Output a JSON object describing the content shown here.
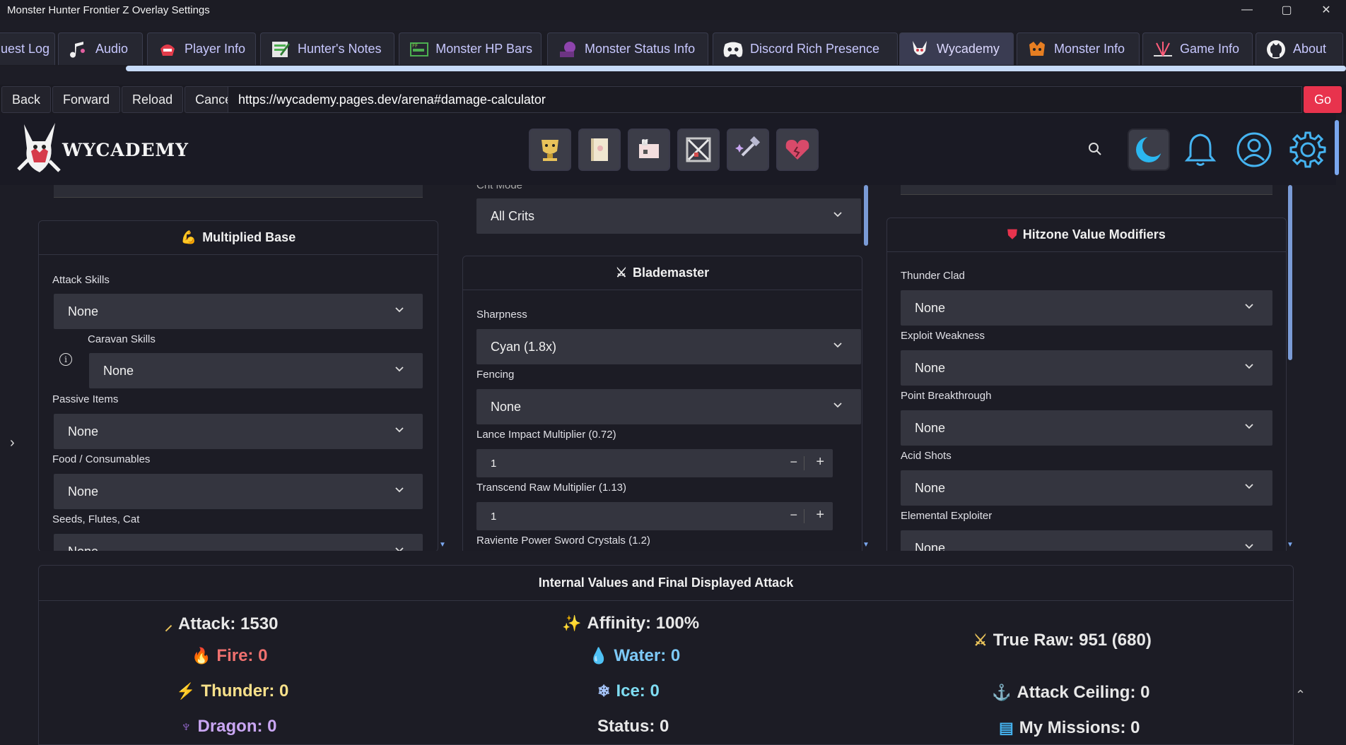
{
  "window": {
    "title": "Monster Hunter Frontier Z Overlay Settings",
    "minimize": "—",
    "maximize": "▢",
    "close": "✕"
  },
  "tabs": [
    {
      "label": "uest Log",
      "icon": "quest-log-icon"
    },
    {
      "label": "Audio",
      "icon": "music-note-icon"
    },
    {
      "label": "Player Info",
      "icon": "player-helmet-icon"
    },
    {
      "label": "Hunter's Notes",
      "icon": "notes-icon"
    },
    {
      "label": "Monster HP Bars",
      "icon": "hp-bars-icon"
    },
    {
      "label": "Monster Status Info",
      "icon": "status-icon"
    },
    {
      "label": "Discord Rich Presence",
      "icon": "discord-icon"
    },
    {
      "label": "Wycademy",
      "icon": "wycademy-icon"
    },
    {
      "label": "Monster Info",
      "icon": "monster-icon"
    },
    {
      "label": "Game Info",
      "icon": "game-info-icon"
    },
    {
      "label": "About",
      "icon": "github-icon"
    }
  ],
  "nav": {
    "back": "Back",
    "forward": "Forward",
    "reload": "Reload",
    "cancel": "Cancel",
    "url": "https://wycademy.pages.dev/arena#damage-calculator",
    "go": "Go"
  },
  "site": {
    "logo_text": "WYCADEMY"
  },
  "left_column": {
    "panel_title": "Multiplied Base",
    "fields": [
      {
        "label": "Attack Skills",
        "value": "None"
      },
      {
        "label": "Caravan Skills",
        "value": "None"
      },
      {
        "label": "Passive Items",
        "value": "None"
      },
      {
        "label": "Food / Consumables",
        "value": "None"
      },
      {
        "label": "Seeds, Flutes, Cat",
        "value": "None"
      }
    ]
  },
  "middle_column": {
    "crit_mode_label": "Crit Mode",
    "crit_mode_value": "All Crits",
    "panel_title": "Blademaster",
    "sharpness_label": "Sharpness",
    "sharpness_value": "Cyan (1.8x)",
    "fencing_label": "Fencing",
    "fencing_value": "None",
    "lance_label": "Lance Impact Multiplier (0.72)",
    "lance_value": "1",
    "transcend_label": "Transcend Raw Multiplier (1.13)",
    "transcend_value": "1",
    "raviente_label": "Raviente Power Sword Crystals (1.2)"
  },
  "right_column": {
    "panel_title": "Hitzone Value Modifiers",
    "fields": [
      {
        "label": "Thunder Clad",
        "value": "None"
      },
      {
        "label": "Exploit Weakness",
        "value": "None"
      },
      {
        "label": "Point Breakthrough",
        "value": "None"
      },
      {
        "label": "Acid Shots",
        "value": "None"
      },
      {
        "label": "Elemental Exploiter",
        "value": "None"
      }
    ]
  },
  "results": {
    "title": "Internal Values and Final Displayed Attack",
    "attack": "Attack: 1530",
    "fire": "Fire: 0",
    "thunder": "Thunder: 0",
    "dragon": "Dragon: 0",
    "affinity": "Affinity: 100%",
    "water": "Water: 0",
    "ice": "Ice: 0",
    "status": "Status: 0",
    "true_raw": "True Raw: 951 (680)",
    "attack_ceiling": "Attack Ceiling: 0",
    "my_missions": "My Missions: 0"
  },
  "colors": {
    "accent": "#e8334d",
    "fire": "#f0716f",
    "thunder": "#f7e08a",
    "dragon": "#c9a6f2",
    "water": "#7dc9f7",
    "ice": "#7fdcf2",
    "tab_text": "#c8c8ff"
  }
}
